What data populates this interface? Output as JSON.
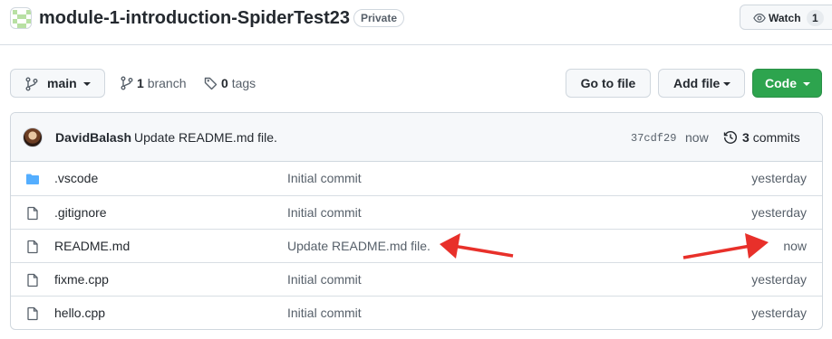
{
  "repo": {
    "name": "module-1-introduction-SpiderTest23",
    "visibility": "Private"
  },
  "watch": {
    "label": "Watch",
    "count": "1"
  },
  "toolbar": {
    "branch": "main",
    "branch_count": "1",
    "branch_label": "branch",
    "tag_count": "0",
    "tag_label": "tags",
    "goto_file": "Go to file",
    "add_file": "Add file",
    "code": "Code"
  },
  "commit": {
    "author": "DavidBalash",
    "message": "Update README.md file.",
    "sha": "37cdf29",
    "time": "now",
    "commits_count": "3",
    "commits_label": "commits"
  },
  "files": [
    {
      "name": ".vscode",
      "type": "folder",
      "message": "Initial commit",
      "age": "yesterday"
    },
    {
      "name": ".gitignore",
      "type": "file",
      "message": "Initial commit",
      "age": "yesterday"
    },
    {
      "name": "README.md",
      "type": "file",
      "message": "Update README.md file.",
      "age": "now"
    },
    {
      "name": "fixme.cpp",
      "type": "file",
      "message": "Initial commit",
      "age": "yesterday"
    },
    {
      "name": "hello.cpp",
      "type": "file",
      "message": "Initial commit",
      "age": "yesterday"
    }
  ],
  "icons": {
    "repo_avatar": "identicon",
    "watch": "eye-icon",
    "branch": "git-branch-icon",
    "tag": "tag-icon",
    "history": "history-icon",
    "folder": "folder-icon",
    "file": "file-icon"
  },
  "colors": {
    "accent_green": "#2da44e",
    "folder_blue": "#54aeff",
    "annotation_red": "#e8302a"
  }
}
